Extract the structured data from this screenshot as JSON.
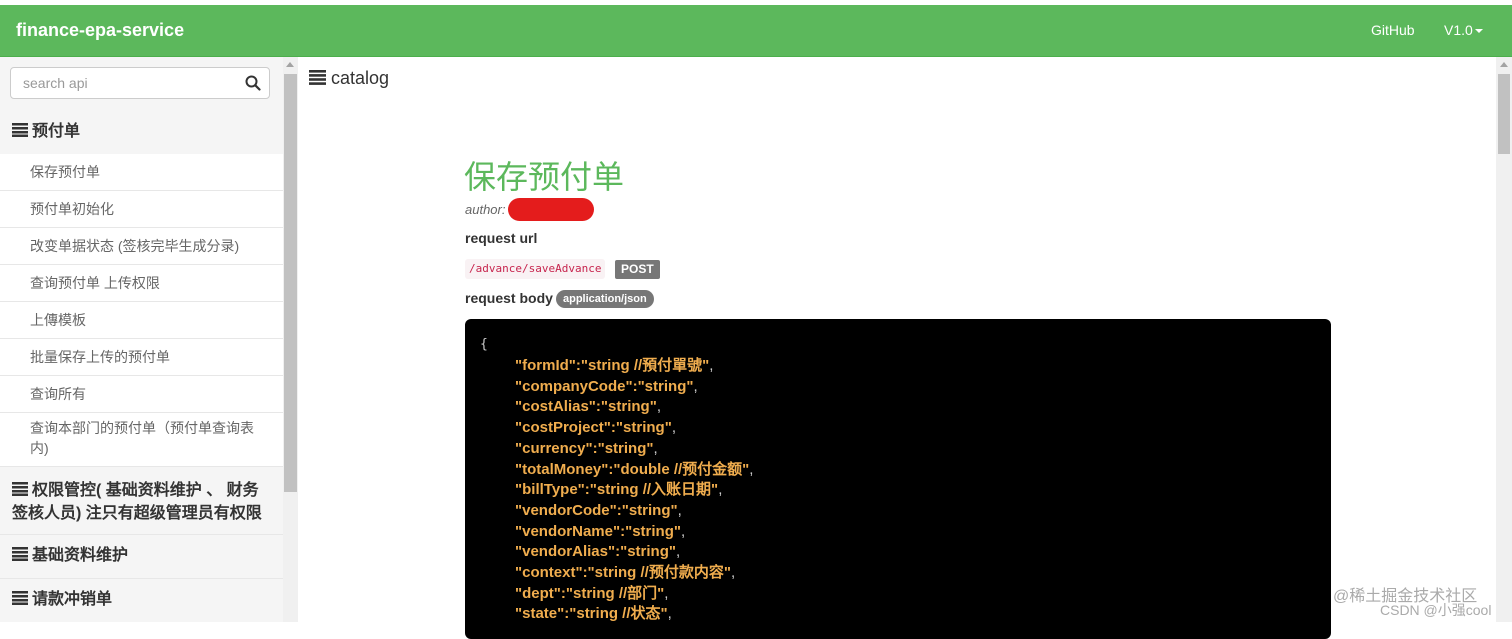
{
  "app": {
    "brand": "finance-epa-service"
  },
  "nav": {
    "github": "GitHub",
    "version": "V1.0"
  },
  "search": {
    "placeholder": "search api"
  },
  "sidebar": {
    "groups": [
      {
        "title": "预付单"
      },
      {
        "title": "权限管控( 基础资料维护 、 财务签核人员) 注只有超级管理员有权限"
      },
      {
        "title": "基础资料维护"
      },
      {
        "title": "请款冲销单"
      }
    ],
    "items": [
      {
        "label": "保存预付单"
      },
      {
        "label": "预付单初始化"
      },
      {
        "label": "改变单据状态 (签核完毕生成分录)"
      },
      {
        "label": "查询预付单 上传权限"
      },
      {
        "label": "上傳模板"
      },
      {
        "label": "批量保存上传的预付单"
      },
      {
        "label": "查询所有"
      },
      {
        "label": "查询本部门的预付单（预付单查询表内)"
      }
    ]
  },
  "main": {
    "catalog": "catalog",
    "title": "保存预付单",
    "author_label": "author:",
    "request_url_label": "request url",
    "url": "/advance/saveAdvance",
    "method": "POST",
    "request_body_label": "request body",
    "content_type": "application/json",
    "code": {
      "open": "{",
      "lines": [
        {
          "text": "\"formId\":\"string //預付單號\"",
          "tail": ","
        },
        {
          "text": "\"companyCode\":\"string\"",
          "tail": ","
        },
        {
          "text": "\"costAlias\":\"string\"",
          "tail": ","
        },
        {
          "text": "\"costProject\":\"string\"",
          "tail": ","
        },
        {
          "text": "\"currency\":\"string\"",
          "tail": ","
        },
        {
          "text": "\"totalMoney\":\"double //预付金额\"",
          "tail": ","
        },
        {
          "text": "\"billType\":\"string //入账日期\"",
          "tail": ","
        },
        {
          "text": "\"vendorCode\":\"string\"",
          "tail": ","
        },
        {
          "text": "\"vendorName\":\"string\"",
          "tail": ","
        },
        {
          "text": "\"vendorAlias\":\"string\"",
          "tail": ","
        },
        {
          "text": "\"context\":\"string //预付款内容\"",
          "tail": ","
        },
        {
          "text": "\"dept\":\"string //部门\"",
          "tail": ","
        },
        {
          "text": "\"state\":\"string //状态\"",
          "tail": ","
        }
      ]
    }
  },
  "watermark": {
    "line1": "@稀土掘金技术社区",
    "line2": "CSDN @小强cool"
  },
  "colors": {
    "navbar": "#5cb85c",
    "title": "#5cb85c",
    "code_bg": "#000000",
    "code_text": "#f0ad4e"
  }
}
